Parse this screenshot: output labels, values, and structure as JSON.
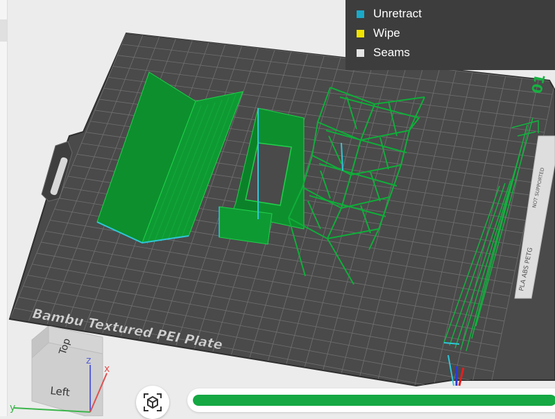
{
  "legend": {
    "items": [
      {
        "label": "Unretract",
        "color": "#1aa9c9"
      },
      {
        "label": "Wipe",
        "color": "#f2e400"
      },
      {
        "label": "Seams",
        "color": "#e5e5e5"
      }
    ]
  },
  "plate": {
    "name": "Bambu Textured PEI Plate",
    "plate_number": "01",
    "side_labels": [
      "PLA ABS PETG",
      "NOT SUPPORTED"
    ]
  },
  "view_cube": {
    "faces": {
      "top": "Top",
      "left": "Left"
    },
    "axes": {
      "x": "x",
      "y": "y",
      "z": "z"
    },
    "axis_colors": {
      "x": "#e05050",
      "y": "#3ab54a",
      "z": "#5860d8"
    }
  },
  "toolbar": {
    "fit_view_icon": "fit-view-icon"
  },
  "layer_slider": {
    "progress": 1.0,
    "color": "#15a843"
  },
  "colors": {
    "plate_fill": "#4a4a4a",
    "plate_grid": "#7a7a7a",
    "model_green": "#0d8f2e",
    "model_line": "#1fd24a",
    "seam_blue": "#2fc7d9"
  }
}
